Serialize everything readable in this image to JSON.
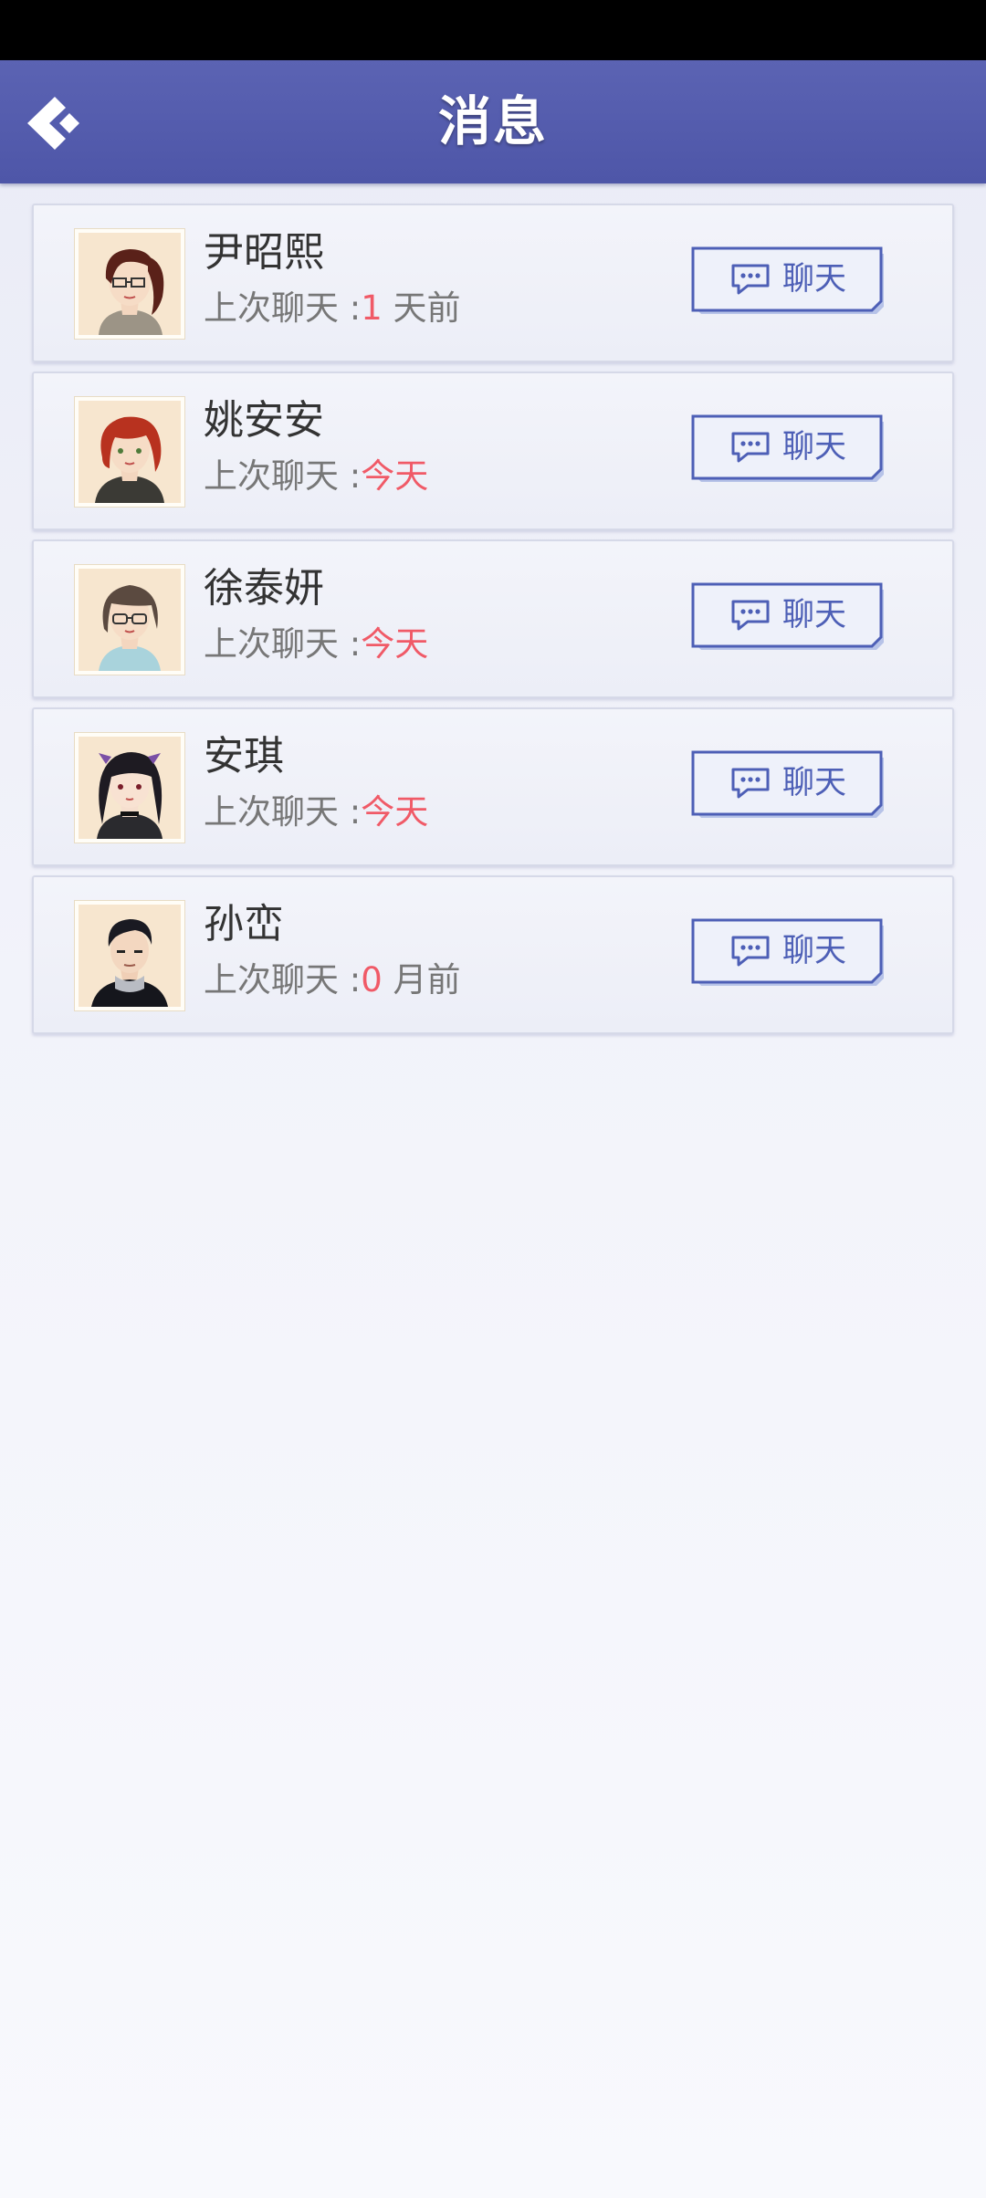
{
  "header": {
    "title": "消息",
    "back_icon": "back-arrow-icon"
  },
  "colors": {
    "header_bg": "#4e56a8",
    "highlight": "#f05a67",
    "button_text": "#4d5fb6"
  },
  "contacts": [
    {
      "name": "尹昭熙",
      "last_chat_label": "上次聊天 :",
      "last_chat_value": "1",
      "last_chat_suffix": " 天前",
      "button_label": "聊天",
      "avatar": "avatar-woman-ponytail-glasses"
    },
    {
      "name": "姚安安",
      "last_chat_label": "上次聊天 :",
      "last_chat_value": "今天",
      "last_chat_suffix": "",
      "button_label": "聊天",
      "avatar": "avatar-woman-red-hair"
    },
    {
      "name": "徐泰妍",
      "last_chat_label": "上次聊天 :",
      "last_chat_value": "今天",
      "last_chat_suffix": "",
      "button_label": "聊天",
      "avatar": "avatar-woman-bob-glasses"
    },
    {
      "name": "安琪",
      "last_chat_label": "上次聊天 :",
      "last_chat_value": "今天",
      "last_chat_suffix": "",
      "button_label": "聊天",
      "avatar": "avatar-woman-black-twintails"
    },
    {
      "name": "孙峦",
      "last_chat_label": "上次聊天 :",
      "last_chat_value": "0",
      "last_chat_suffix": " 月前",
      "button_label": "聊天",
      "avatar": "avatar-man-dark-hair"
    }
  ]
}
